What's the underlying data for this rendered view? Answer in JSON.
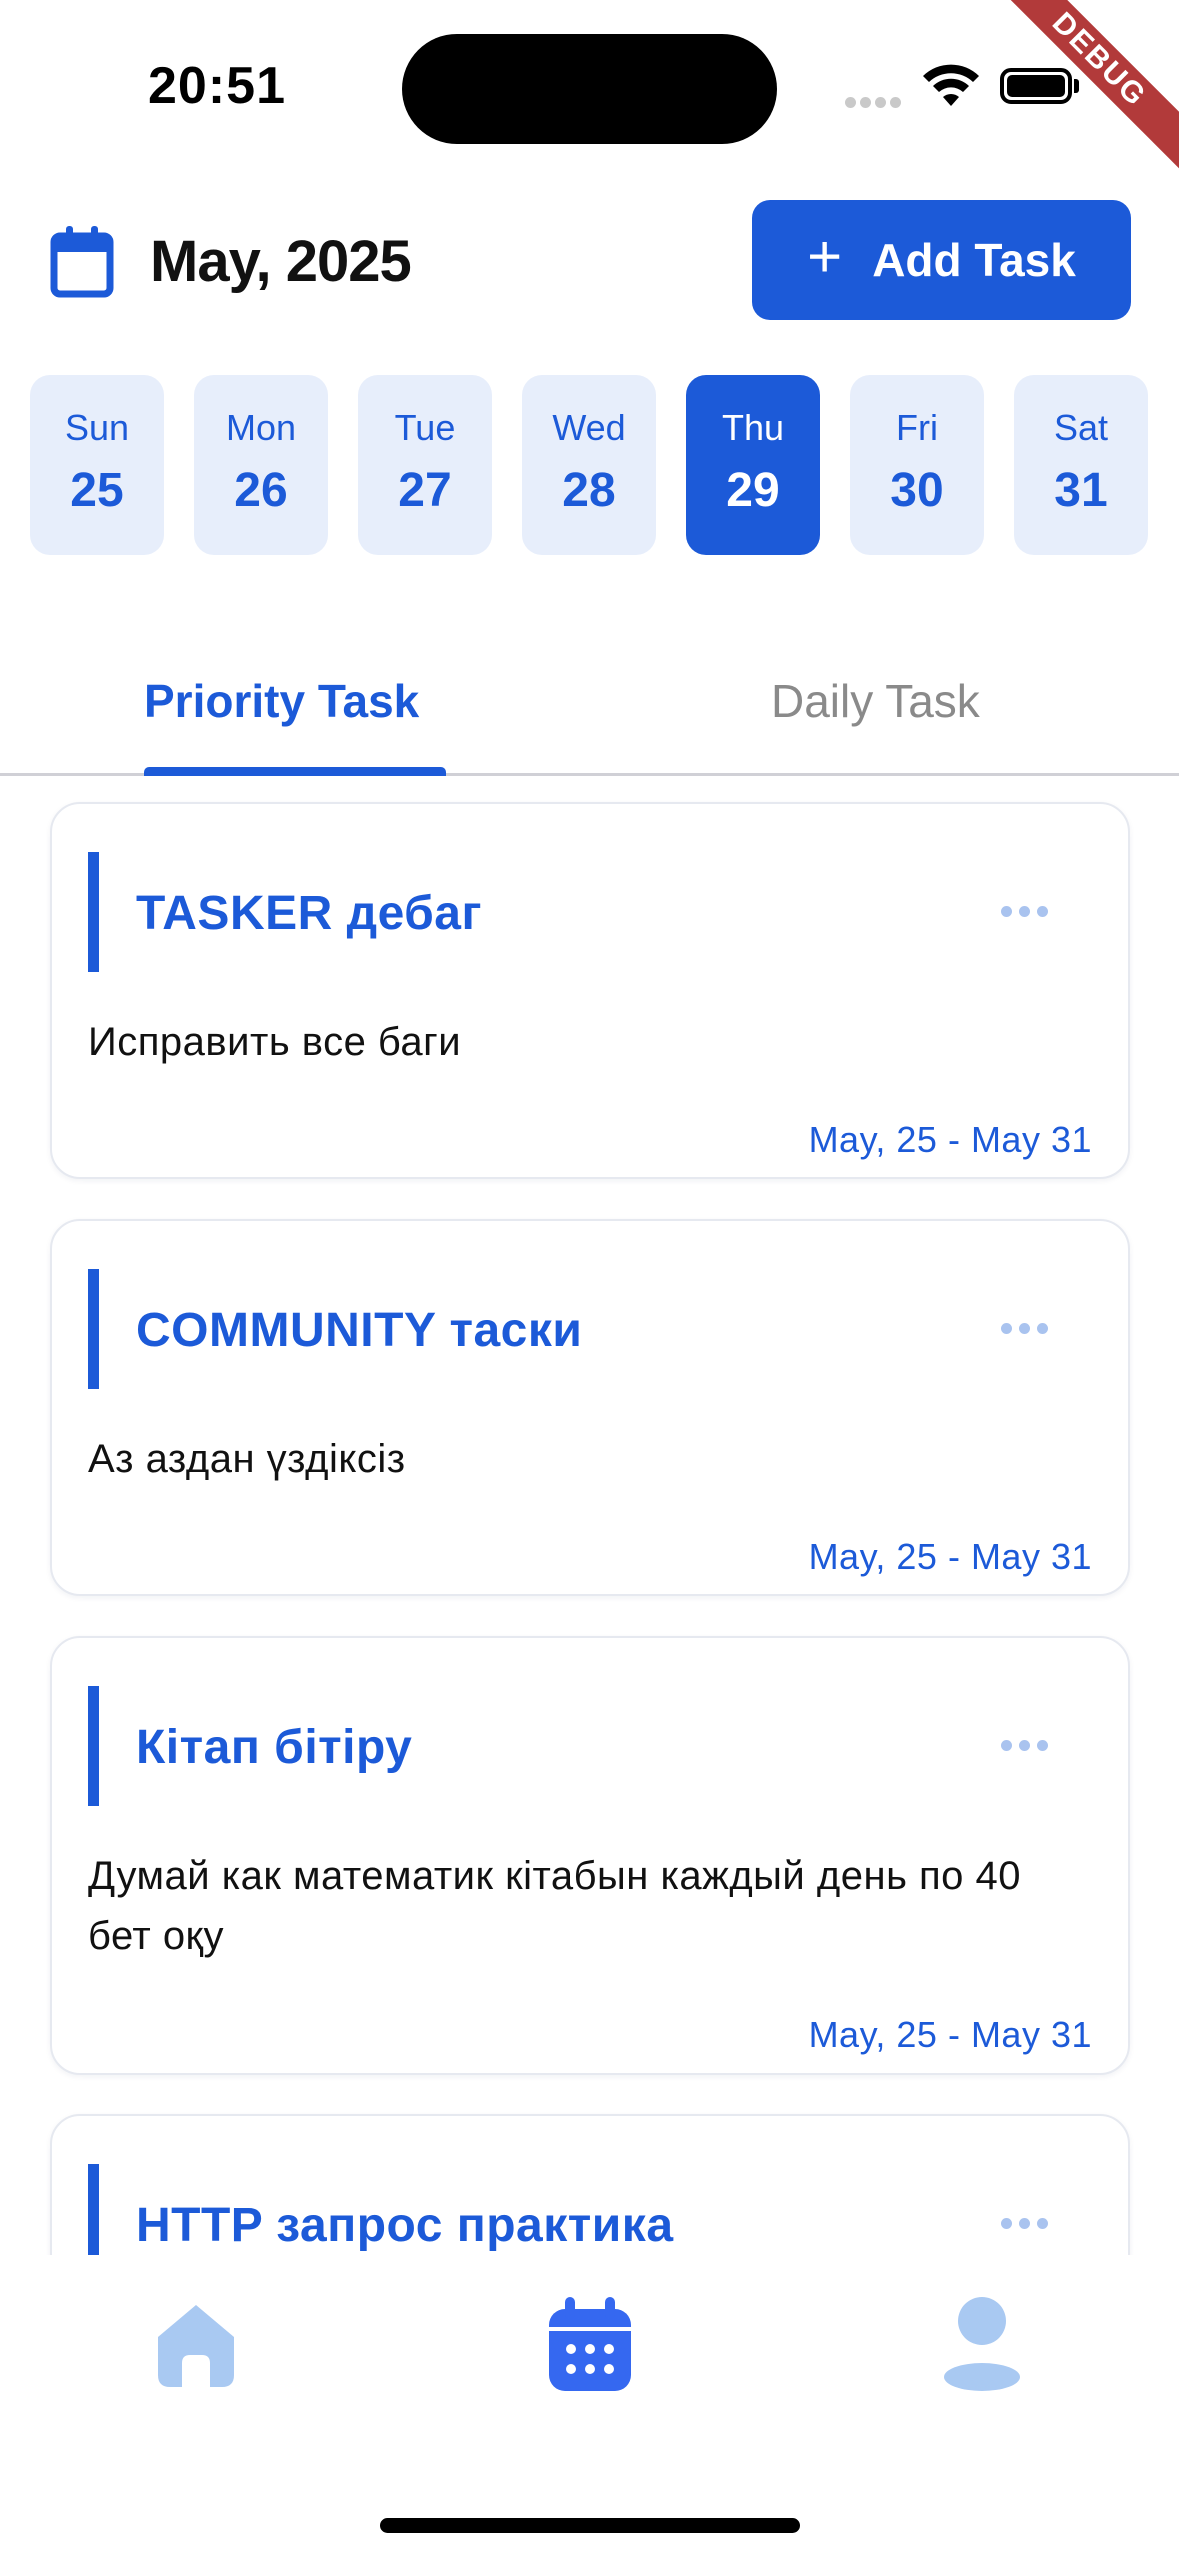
{
  "status_bar": {
    "time": "20:51",
    "debug_label": "DEBUG"
  },
  "header": {
    "month_title": "May, 2025",
    "add_button_label": "Add Task",
    "add_button_icon": "plus-icon"
  },
  "days": [
    {
      "name": "Sun",
      "num": "25",
      "selected": false
    },
    {
      "name": "Mon",
      "num": "26",
      "selected": false
    },
    {
      "name": "Tue",
      "num": "27",
      "selected": false
    },
    {
      "name": "Wed",
      "num": "28",
      "selected": false
    },
    {
      "name": "Thu",
      "num": "29",
      "selected": true
    },
    {
      "name": "Fri",
      "num": "30",
      "selected": false
    },
    {
      "name": "Sat",
      "num": "31",
      "selected": false
    }
  ],
  "tabs": [
    {
      "label": "Priority Task",
      "active": true
    },
    {
      "label": "Daily Task",
      "active": false
    }
  ],
  "tasks": [
    {
      "title": "TASKER дебаг",
      "description": "Исправить все баги",
      "dates": "May, 25 - May 31"
    },
    {
      "title": "COMMUNITY таски",
      "description": "Аз аздан үздіксіз",
      "dates": "May, 25 - May 31"
    },
    {
      "title": "Кітап бітіру",
      "description": "Думай как математик кітабын каждый день по 40 бет оқу",
      "dates": "May, 25 - May 31"
    },
    {
      "title": "HTTP запрос практика",
      "description": "",
      "dates": ""
    }
  ],
  "bottom_nav": [
    {
      "icon": "home-icon",
      "active": false
    },
    {
      "icon": "calendar-icon",
      "active": true
    },
    {
      "icon": "profile-icon",
      "active": false
    }
  ],
  "colors": {
    "accent": "#1c5ad8",
    "day_bg": "#e7eefb",
    "nav_inactive": "#a9c9f2",
    "nav_active": "#3568f0"
  }
}
